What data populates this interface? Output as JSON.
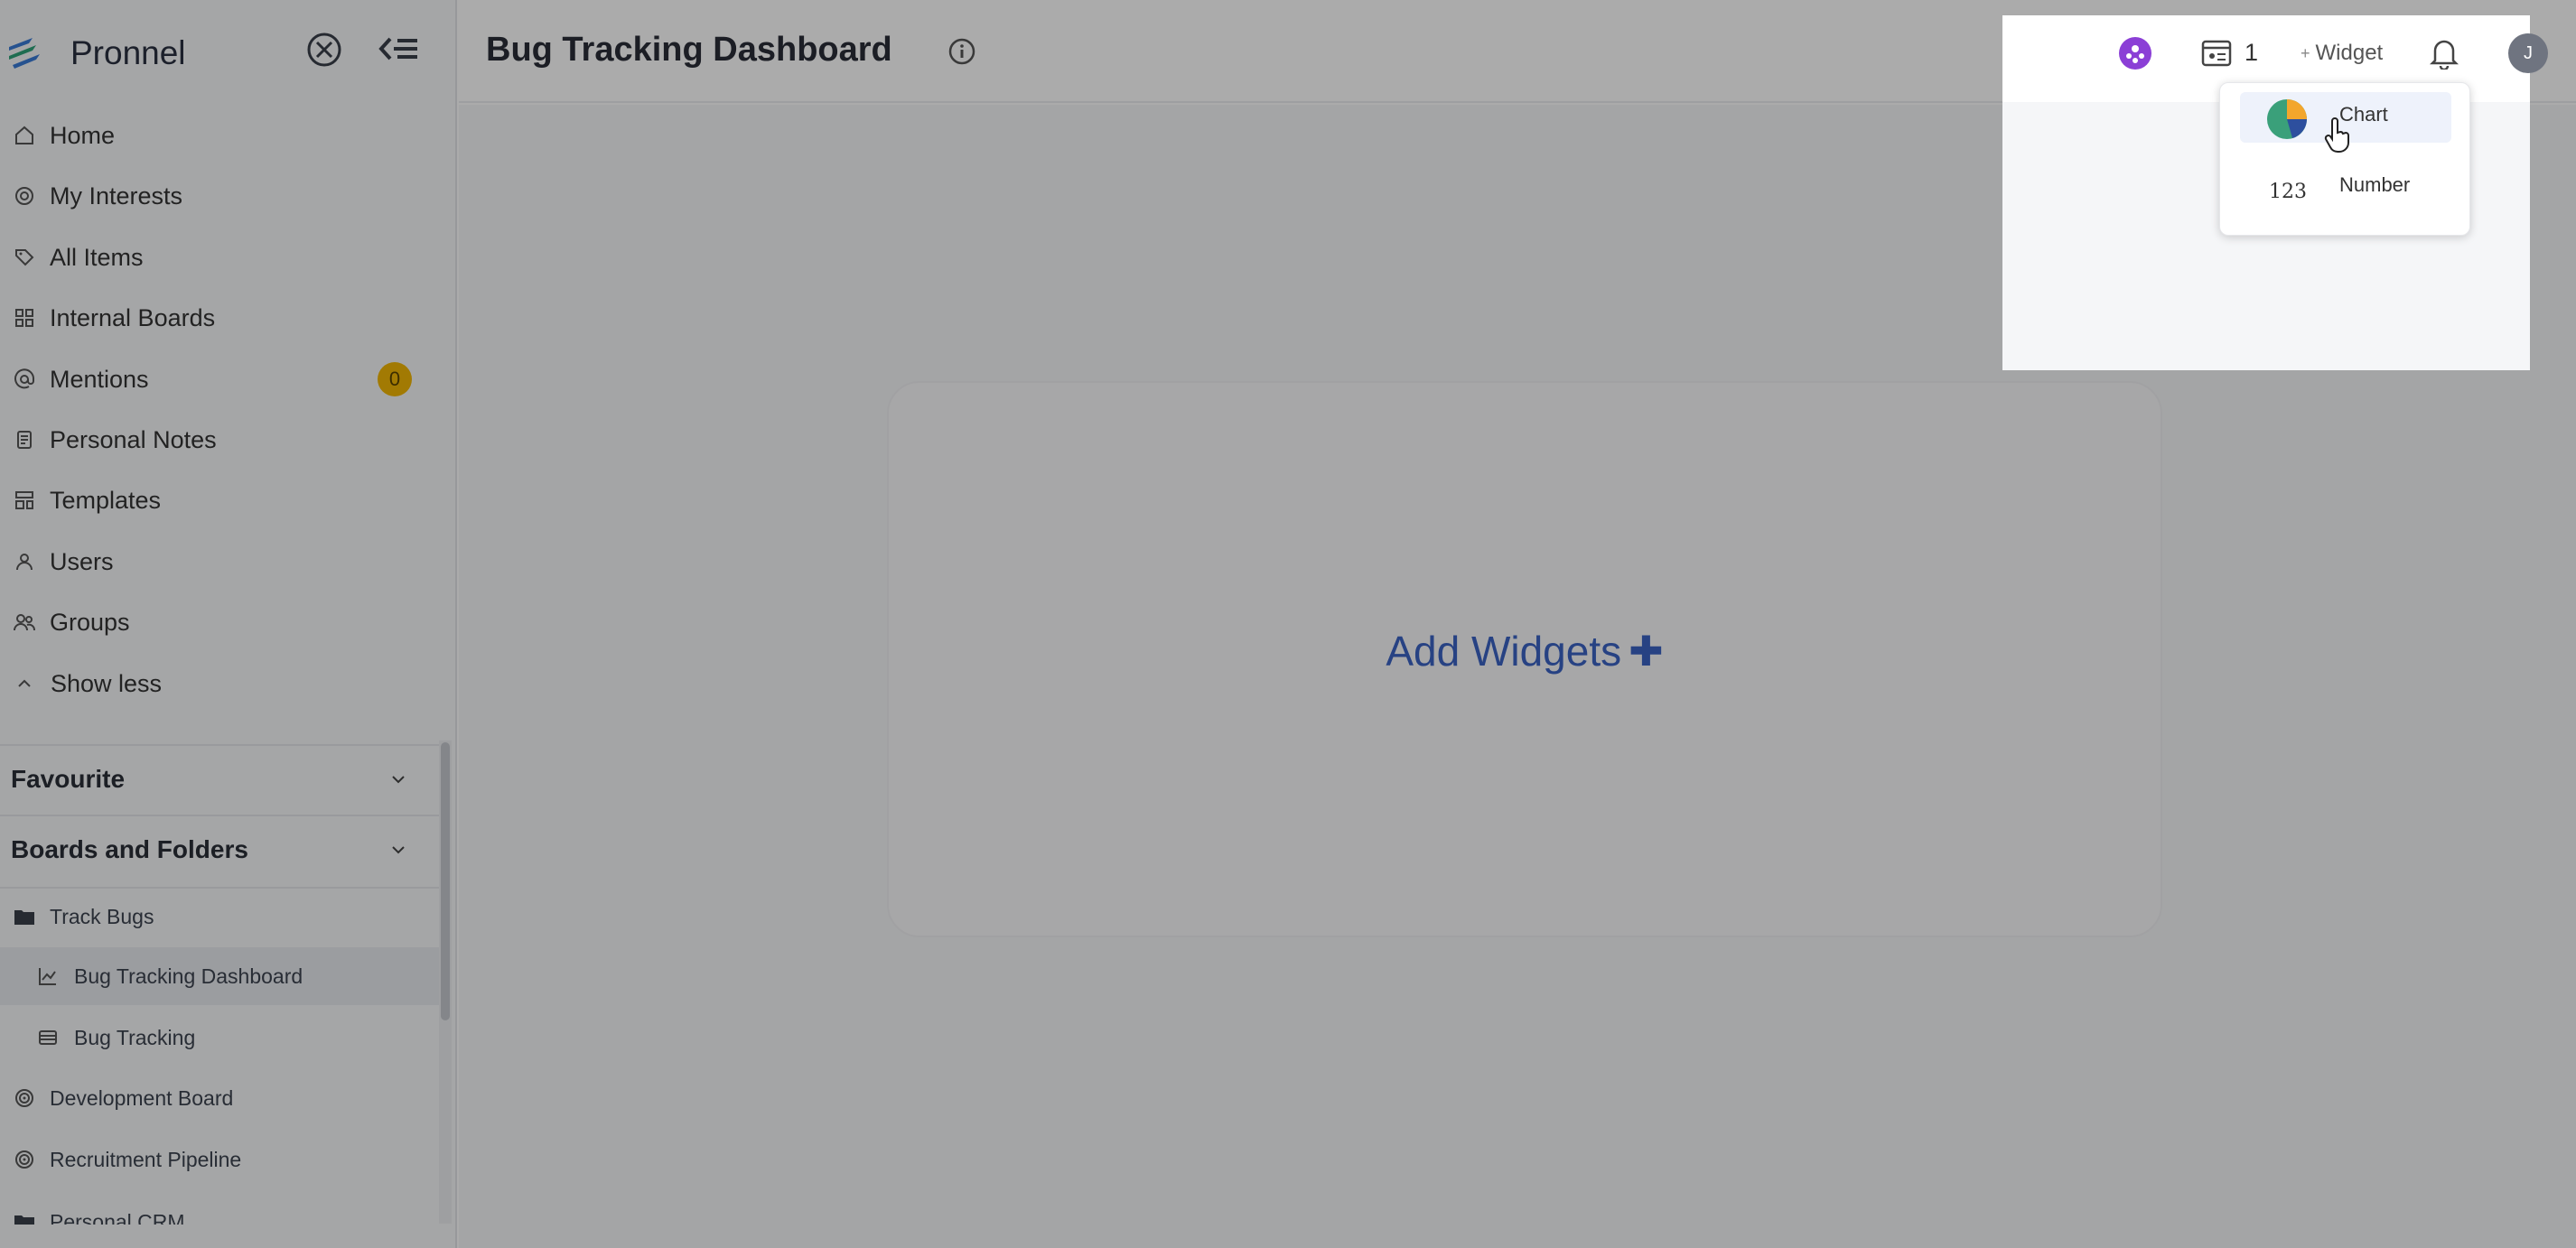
{
  "app": {
    "name": "Pronnel"
  },
  "header": {
    "title": "Bug Tracking Dashboard"
  },
  "sidebar": {
    "nav": [
      {
        "label": "Home",
        "icon": "home-icon"
      },
      {
        "label": "My Interests",
        "icon": "target-icon"
      },
      {
        "label": "All Items",
        "icon": "tag-icon"
      },
      {
        "label": "Internal Boards",
        "icon": "grid-icon"
      },
      {
        "label": "Mentions",
        "icon": "at-icon",
        "badge": "0"
      },
      {
        "label": "Personal Notes",
        "icon": "note-icon"
      },
      {
        "label": "Templates",
        "icon": "template-icon"
      },
      {
        "label": "Users",
        "icon": "user-icon"
      },
      {
        "label": "Groups",
        "icon": "group-icon"
      },
      {
        "label": "Show less",
        "icon": "chevron-up-icon"
      }
    ],
    "sections": [
      {
        "label": "Favourite"
      },
      {
        "label": "Boards and Folders"
      }
    ],
    "tree": [
      {
        "label": "Track Bugs",
        "icon": "folder-icon"
      },
      {
        "label": "Bug Tracking Dashboard",
        "icon": "dashboard-icon"
      },
      {
        "label": "Bug Tracking",
        "icon": "board-icon"
      },
      {
        "label": "Development Board",
        "icon": "target-icon"
      },
      {
        "label": "Recruitment Pipeline",
        "icon": "target-icon"
      },
      {
        "label": "Personal CRM",
        "icon": "folder-icon"
      }
    ]
  },
  "main": {
    "add_widgets_label": "Add Widgets",
    "add_plus": "✚"
  },
  "topbar": {
    "count": "1",
    "widget_label": "Widget",
    "widget_plus": "+",
    "avatar_initial": "J"
  },
  "dropdown": {
    "items": [
      {
        "label": "Chart",
        "icon": "pie-chart-icon"
      },
      {
        "label": "Number",
        "glyph": "123"
      }
    ]
  },
  "colors": {
    "accent": "#3b63c4",
    "badge": "#f2b705",
    "avatar": "#6f7480",
    "purple": "#8b3fd6"
  }
}
